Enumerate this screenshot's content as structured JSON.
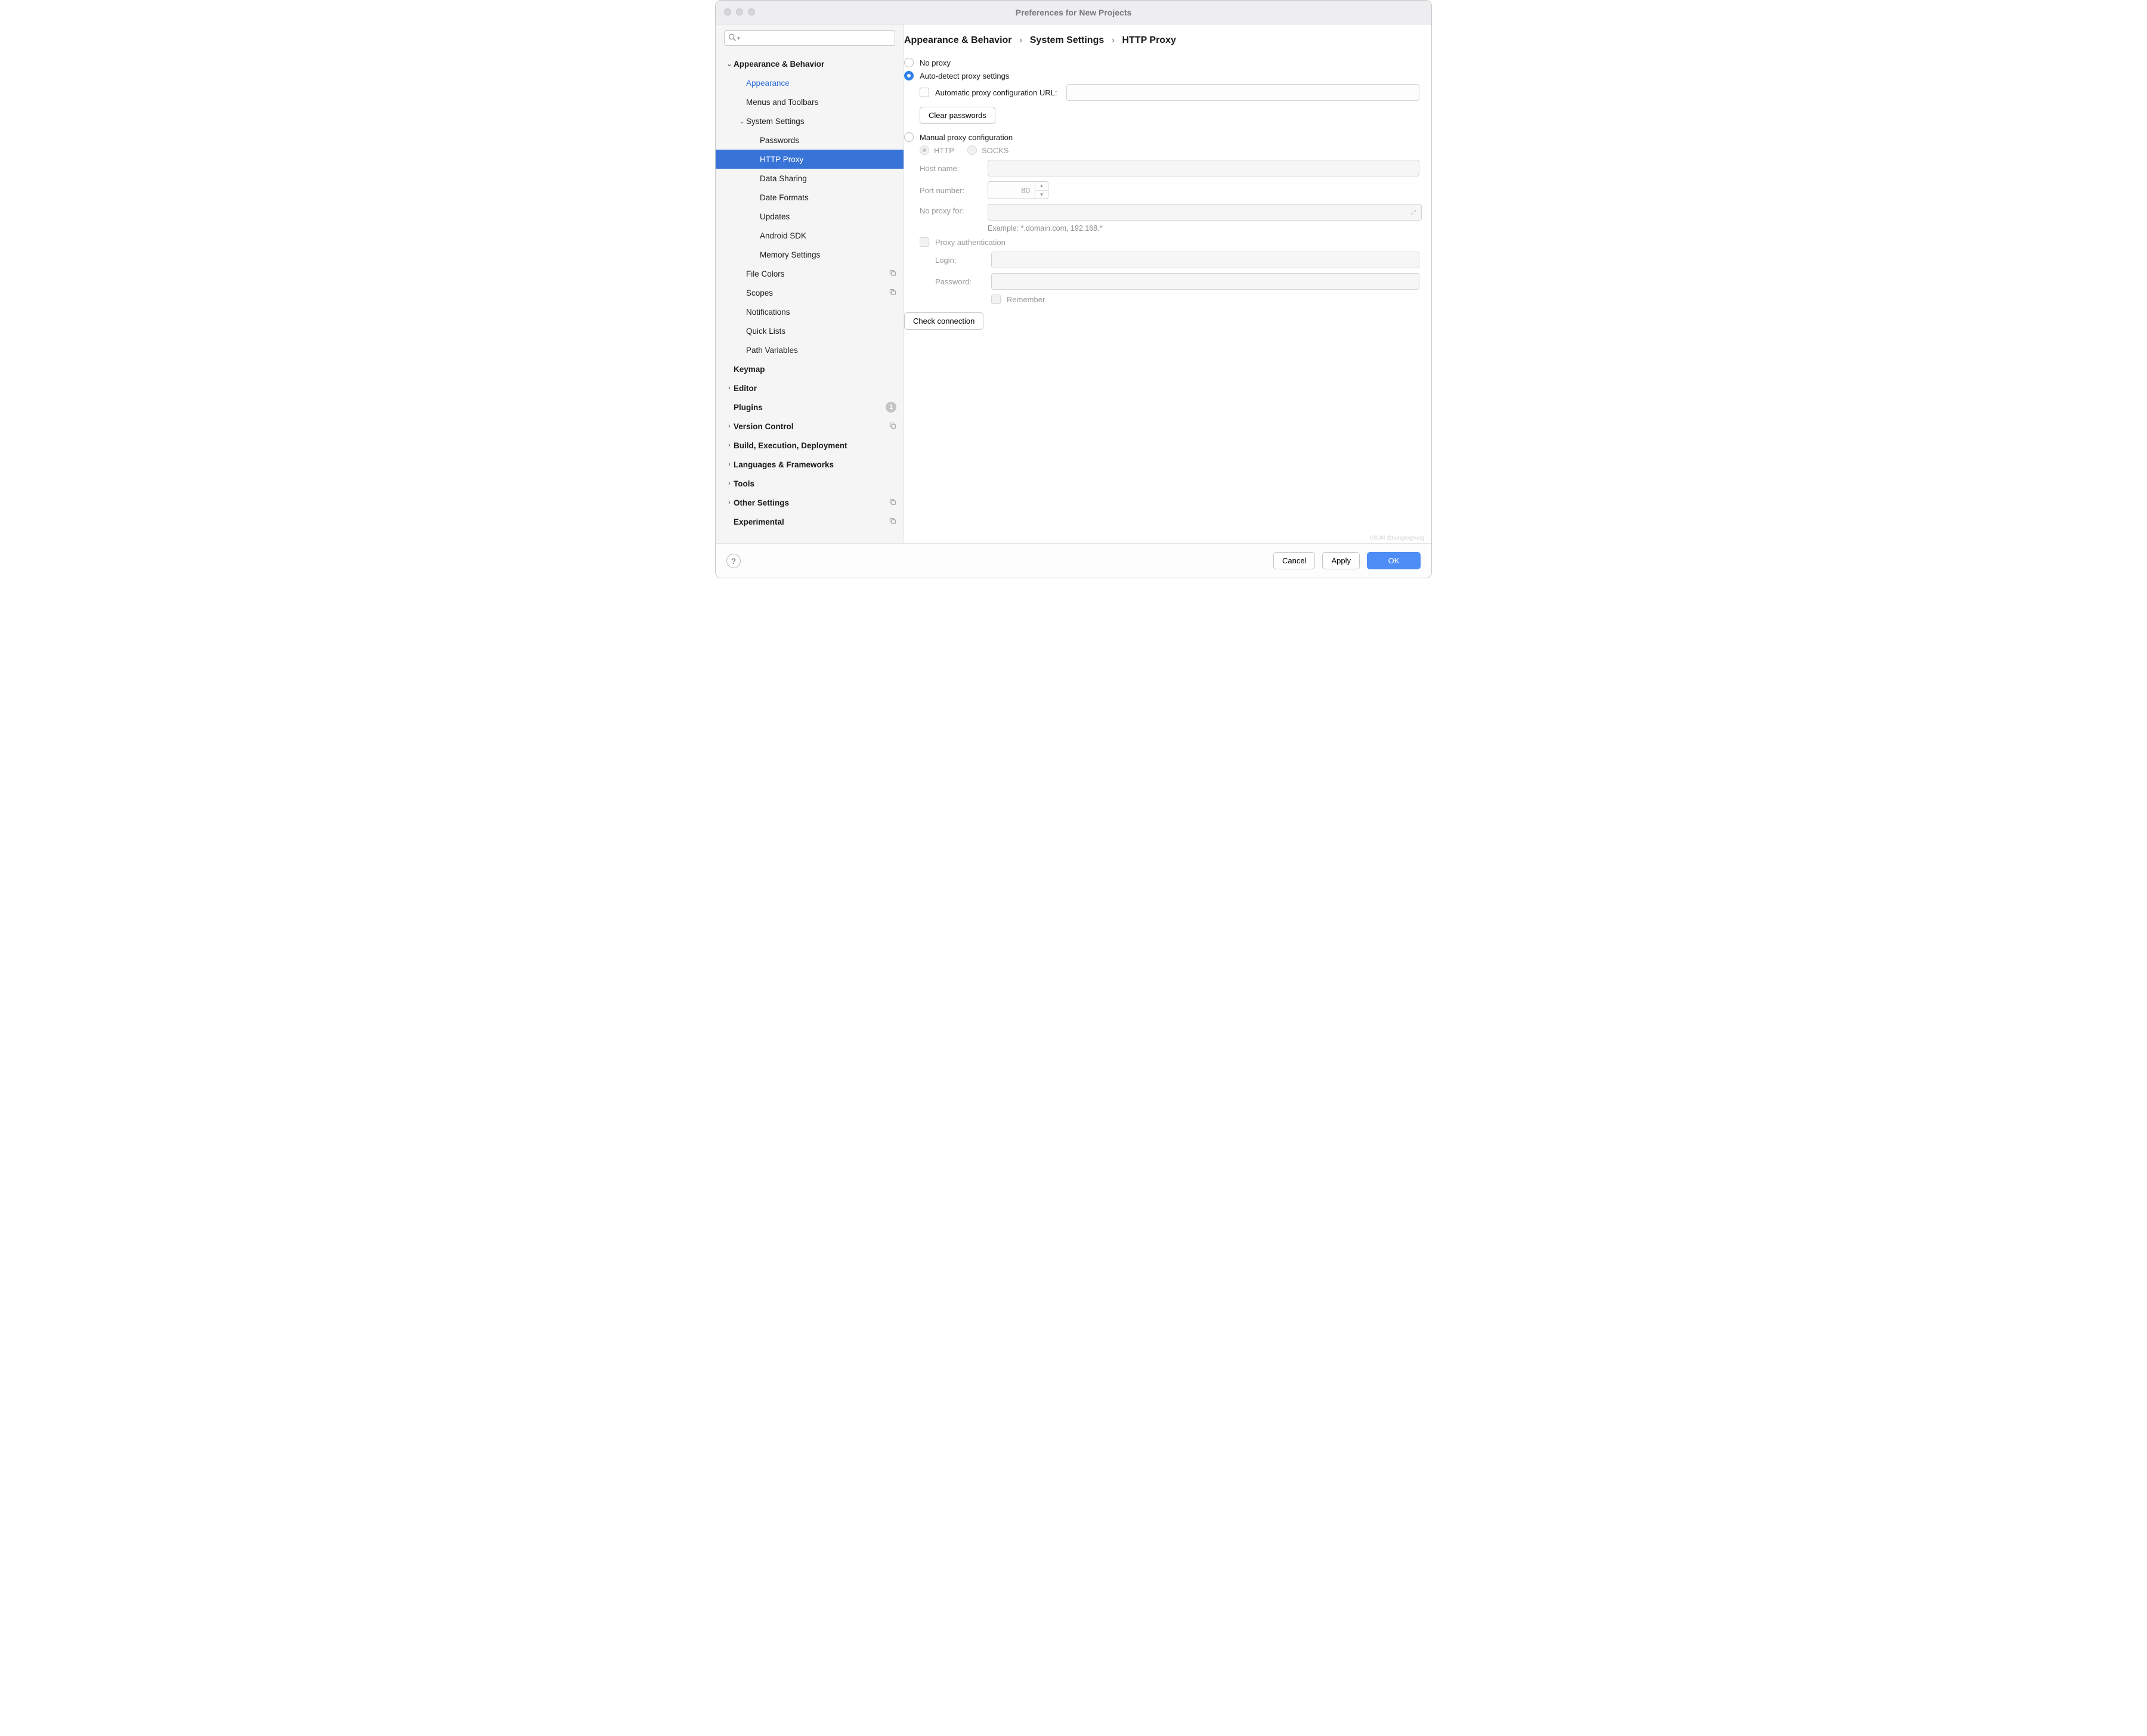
{
  "window": {
    "title": "Preferences for New Projects"
  },
  "search": {
    "placeholder": ""
  },
  "sidebar": {
    "items": [
      {
        "label": "Appearance & Behavior",
        "depth": 0,
        "bold": true,
        "expanded": true
      },
      {
        "label": "Appearance",
        "depth": 1,
        "link": true
      },
      {
        "label": "Menus and Toolbars",
        "depth": 1
      },
      {
        "label": "System Settings",
        "depth": 1,
        "expanded": true
      },
      {
        "label": "Passwords",
        "depth": 2
      },
      {
        "label": "HTTP Proxy",
        "depth": 2,
        "active": true
      },
      {
        "label": "Data Sharing",
        "depth": 2
      },
      {
        "label": "Date Formats",
        "depth": 2
      },
      {
        "label": "Updates",
        "depth": 2
      },
      {
        "label": "Android SDK",
        "depth": 2
      },
      {
        "label": "Memory Settings",
        "depth": 2
      },
      {
        "label": "File Colors",
        "depth": 1,
        "dup": true
      },
      {
        "label": "Scopes",
        "depth": 1,
        "dup": true
      },
      {
        "label": "Notifications",
        "depth": 1
      },
      {
        "label": "Quick Lists",
        "depth": 1
      },
      {
        "label": "Path Variables",
        "depth": 1
      },
      {
        "label": "Keymap",
        "depth": 0,
        "bold": true
      },
      {
        "label": "Editor",
        "depth": 0,
        "bold": true,
        "collapsed": true
      },
      {
        "label": "Plugins",
        "depth": 0,
        "bold": true,
        "badge": "1"
      },
      {
        "label": "Version Control",
        "depth": 0,
        "bold": true,
        "collapsed": true,
        "dup": true
      },
      {
        "label": "Build, Execution, Deployment",
        "depth": 0,
        "bold": true,
        "collapsed": true
      },
      {
        "label": "Languages & Frameworks",
        "depth": 0,
        "bold": true,
        "collapsed": true
      },
      {
        "label": "Tools",
        "depth": 0,
        "bold": true,
        "collapsed": true
      },
      {
        "label": "Other Settings",
        "depth": 0,
        "bold": true,
        "collapsed": true,
        "dup": true
      },
      {
        "label": "Experimental",
        "depth": 0,
        "bold": true,
        "dup": true
      }
    ]
  },
  "breadcrumb": {
    "a": "Appearance & Behavior",
    "b": "System Settings",
    "c": "HTTP Proxy"
  },
  "proxy": {
    "no_proxy": "No proxy",
    "auto_detect": "Auto-detect proxy settings",
    "auto_url_label": "Automatic proxy configuration URL:",
    "auto_url_value": "",
    "clear_passwords": "Clear passwords",
    "manual": "Manual proxy configuration",
    "http": "HTTP",
    "socks": "SOCKS",
    "host_label": "Host name:",
    "host_value": "",
    "port_label": "Port number:",
    "port_value": "80",
    "noproxy_label": "No proxy for:",
    "noproxy_value": "",
    "noproxy_hint": "Example: *.domain.com, 192.168.*",
    "auth_label": "Proxy authentication",
    "login_label": "Login:",
    "login_value": "",
    "password_label": "Password:",
    "password_value": "",
    "remember": "Remember",
    "check_connection": "Check connection"
  },
  "footer": {
    "cancel": "Cancel",
    "apply": "Apply",
    "ok": "OK"
  },
  "watermark": "CSDN @bunglinghung"
}
